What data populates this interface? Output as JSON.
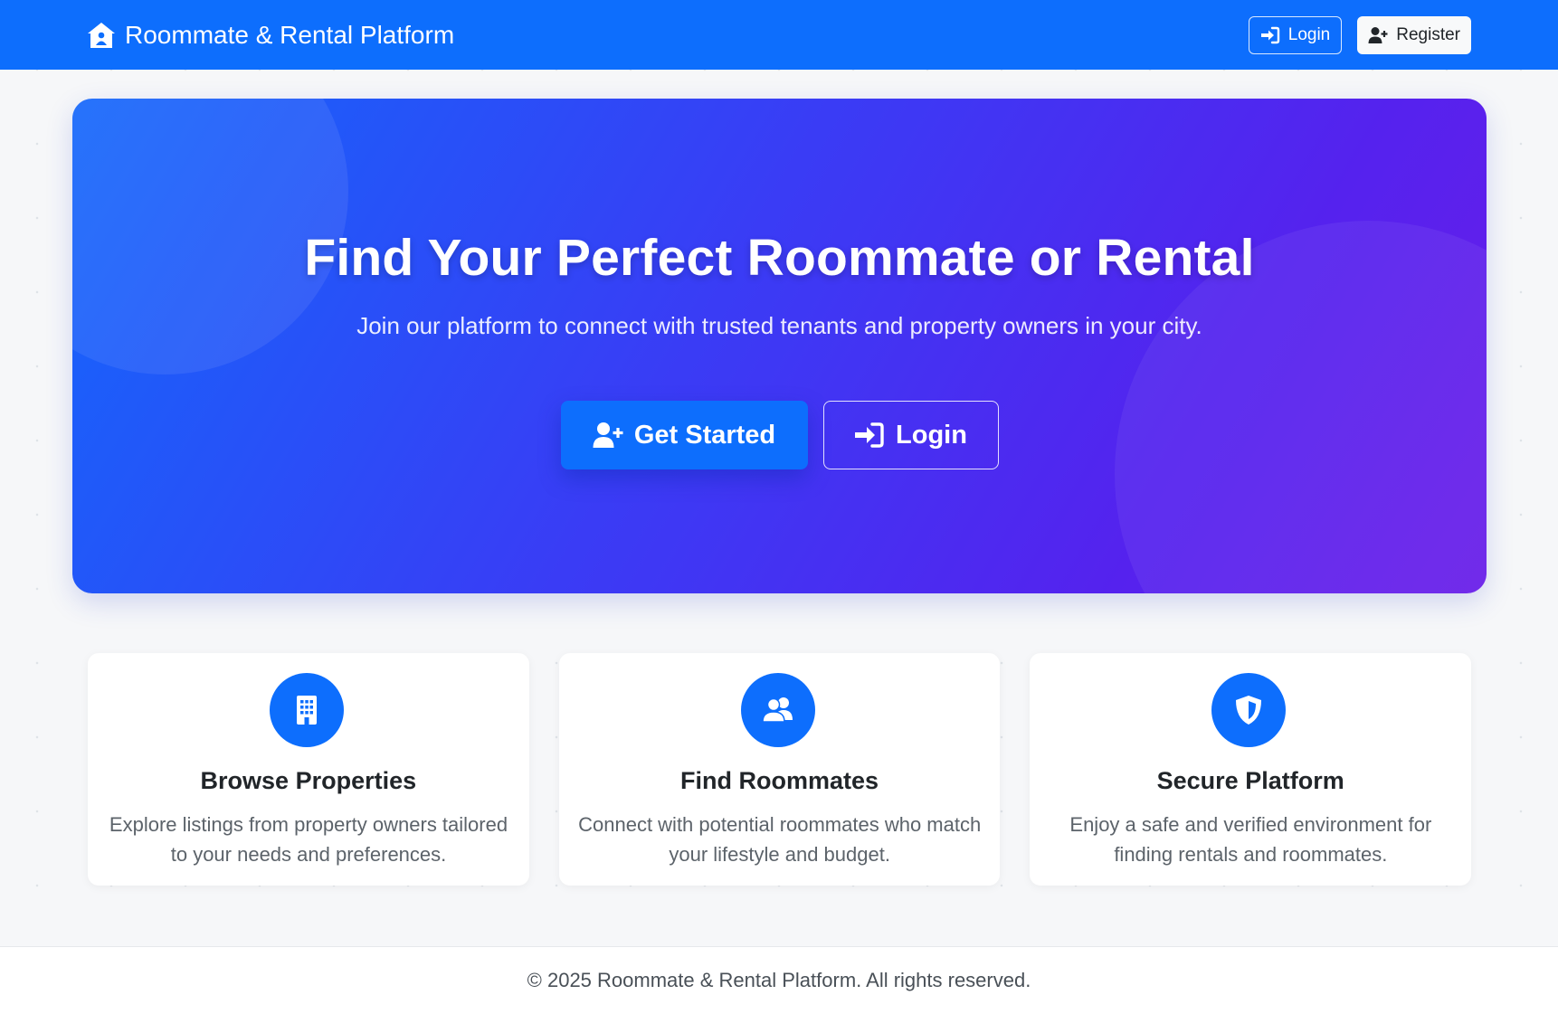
{
  "navbar": {
    "brand": "Roommate & Rental Platform",
    "login_label": "Login",
    "register_label": "Register",
    "icons": [
      "house-icon",
      "sign-in-icon",
      "user-plus-icon"
    ]
  },
  "hero": {
    "title": "Find Your Perfect Roommate or Rental",
    "subtitle": "Join our platform to connect with trusted tenants and property owners in your city.",
    "get_started_label": "Get Started",
    "login_label": "Login"
  },
  "features": [
    {
      "icon": "building-icon",
      "title": "Browse Properties",
      "text": "Explore listings from property owners tailored to your needs and preferences."
    },
    {
      "icon": "users-icon",
      "title": "Find Roommates",
      "text": "Connect with potential roommates who match your lifestyle and budget."
    },
    {
      "icon": "shield-icon",
      "title": "Secure Platform",
      "text": "Enjoy a safe and verified environment for finding rentals and roommates."
    }
  ],
  "footer": {
    "text": "© 2025 Roommate & Rental Platform. All rights reserved."
  },
  "colors": {
    "primary": "#0d6efd",
    "hero_gradient_end": "#6a1ee9",
    "background": "#f6f7f9"
  }
}
